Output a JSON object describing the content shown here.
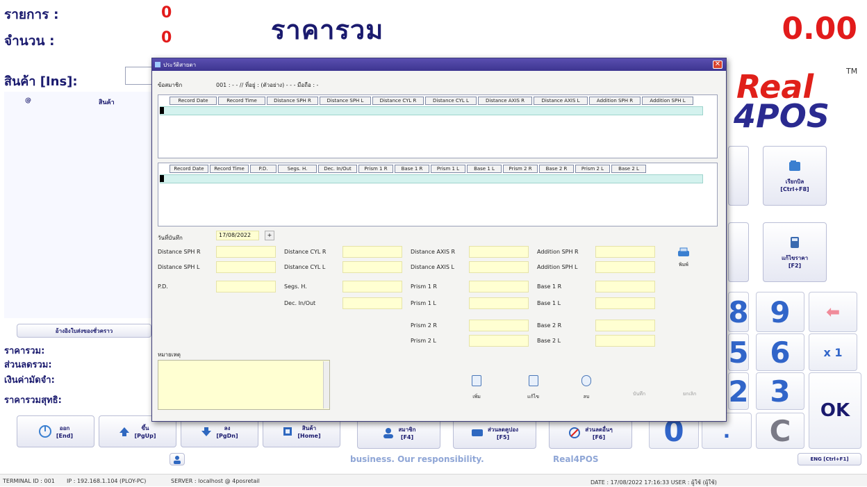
{
  "header": {
    "items_label": "รายการ :",
    "items_value": "0",
    "qty_label": "จำนวน :",
    "qty_value": "0",
    "title": "ราคารวม",
    "total": "0.00"
  },
  "logo": {
    "line1": "Real",
    "line2": "4POS",
    "tm": "TM"
  },
  "left": {
    "product_label": "สินค้า [Ins]:",
    "col_at": "@",
    "col_product": "สินค้า",
    "temp_button": "อ้างอิงใบส่งของชั่วคราว",
    "sum_total": "ราคารวม:",
    "sum_discount": "ส่วนลดรวม:",
    "sum_deposit": "เงินค่ามัดจำ:",
    "sum_net": "ราคารวมสุทธิ:"
  },
  "right_buttons": [
    {
      "label": "เรียกบิล\n[Ctrl+F8]",
      "icon": "folder-icon"
    },
    {
      "label": "แก้ไขราคา\n[F2]",
      "icon": "calculator-icon"
    }
  ],
  "keypad": {
    "k9": "9",
    "k6": "6",
    "k3": "3",
    "x1": "x 1",
    "ok": "OK",
    "k0": "0",
    "dot": ".",
    "clear": "C",
    "k8": "8",
    "k5": "5",
    "k2": "2",
    "back": "⬅"
  },
  "bottom_buttons": [
    {
      "label": "ออก\n[End]",
      "icon": "power-icon"
    },
    {
      "label": "ขึ้น\n[PgUp]",
      "icon": "arrow-up-icon"
    },
    {
      "label": "ลง\n[PgDn]",
      "icon": "arrow-down-icon"
    },
    {
      "label": "สินค้า\n[Home]",
      "icon": "product-icon"
    },
    {
      "label": "สมาชิก\n[F4]",
      "icon": "member-icon"
    },
    {
      "label": "ส่วนลดคูปอง\n[F5]",
      "icon": "coupon-icon"
    },
    {
      "label": "ส่วนลดอื่นๆ\n[F6]",
      "icon": "discount-icon"
    }
  ],
  "footer": {
    "slogan": "business. Our responsibility.",
    "brand": "Real4POS",
    "lang": "ENG [Ctrl+F1]",
    "terminal": "TERMINAL ID : 001",
    "ip": "IP : 192.168.1.104 (PLOY-PC)",
    "server": "SERVER : localhost @ 4posretail",
    "datetime": "DATE : 17/08/2022  17:16:33   USER : ผู้ใช้ (ผู้ใช้)"
  },
  "dialog": {
    "title": "ประวัติสายตา",
    "member_label": "ข้อสมาชิก",
    "member_info": "001 : - - //  ที่อยู่ : (ตัวอย่าง) - - - มือถือ : -",
    "grid1_cols": [
      "Record Date",
      "Record Time",
      "Distance SPH R",
      "Distance SPH L",
      "Distance CYL R",
      "Distance CYL L",
      "Distance AXIS R",
      "Distance AXIS L",
      "Addition SPH R",
      "Addition SPH L"
    ],
    "grid2_cols": [
      "Record Date",
      "Record Time",
      "P.D.",
      "Segs. H.",
      "Dec. In/Out",
      "Prism 1 R",
      "Base 1 R",
      "Prism 1 L",
      "Base 1 L",
      "Prism 2 R",
      "Base 2 R",
      "Prism 2 L",
      "Base 2 L"
    ],
    "date_label": "วันที่บันทึก",
    "date_value": "17/08/2022",
    "f_sph_r": "Distance SPH R",
    "f_sph_l": "Distance SPH L",
    "f_pd": "P.D.",
    "f_cyl_r": "Distance CYL R",
    "f_cyl_l": "Distance CYL L",
    "f_segs": "Segs. H.",
    "f_dec": "Dec. In/Out",
    "f_axis_r": "Distance AXIS R",
    "f_axis_l": "Distance AXIS L",
    "f_p1r": "Prism 1 R",
    "f_p1l": "Prism 1 L",
    "f_p2r": "Prism 2 R",
    "f_p2l": "Prism 2 L",
    "f_add_r": "Addition SPH R",
    "f_add_l": "Addition SPH L",
    "f_b1r": "Base 1 R",
    "f_b1l": "Base 1 L",
    "f_b2r": "Base 2 R",
    "f_b2l": "Base 2 L",
    "print": "พิมพ์",
    "note_label": "หมายเหตุ",
    "actions": {
      "add": "เพิ่ม",
      "edit": "แก้ไข",
      "delete": "ลบ",
      "save": "บันทึก",
      "cancel": "ยกเลิก"
    }
  }
}
